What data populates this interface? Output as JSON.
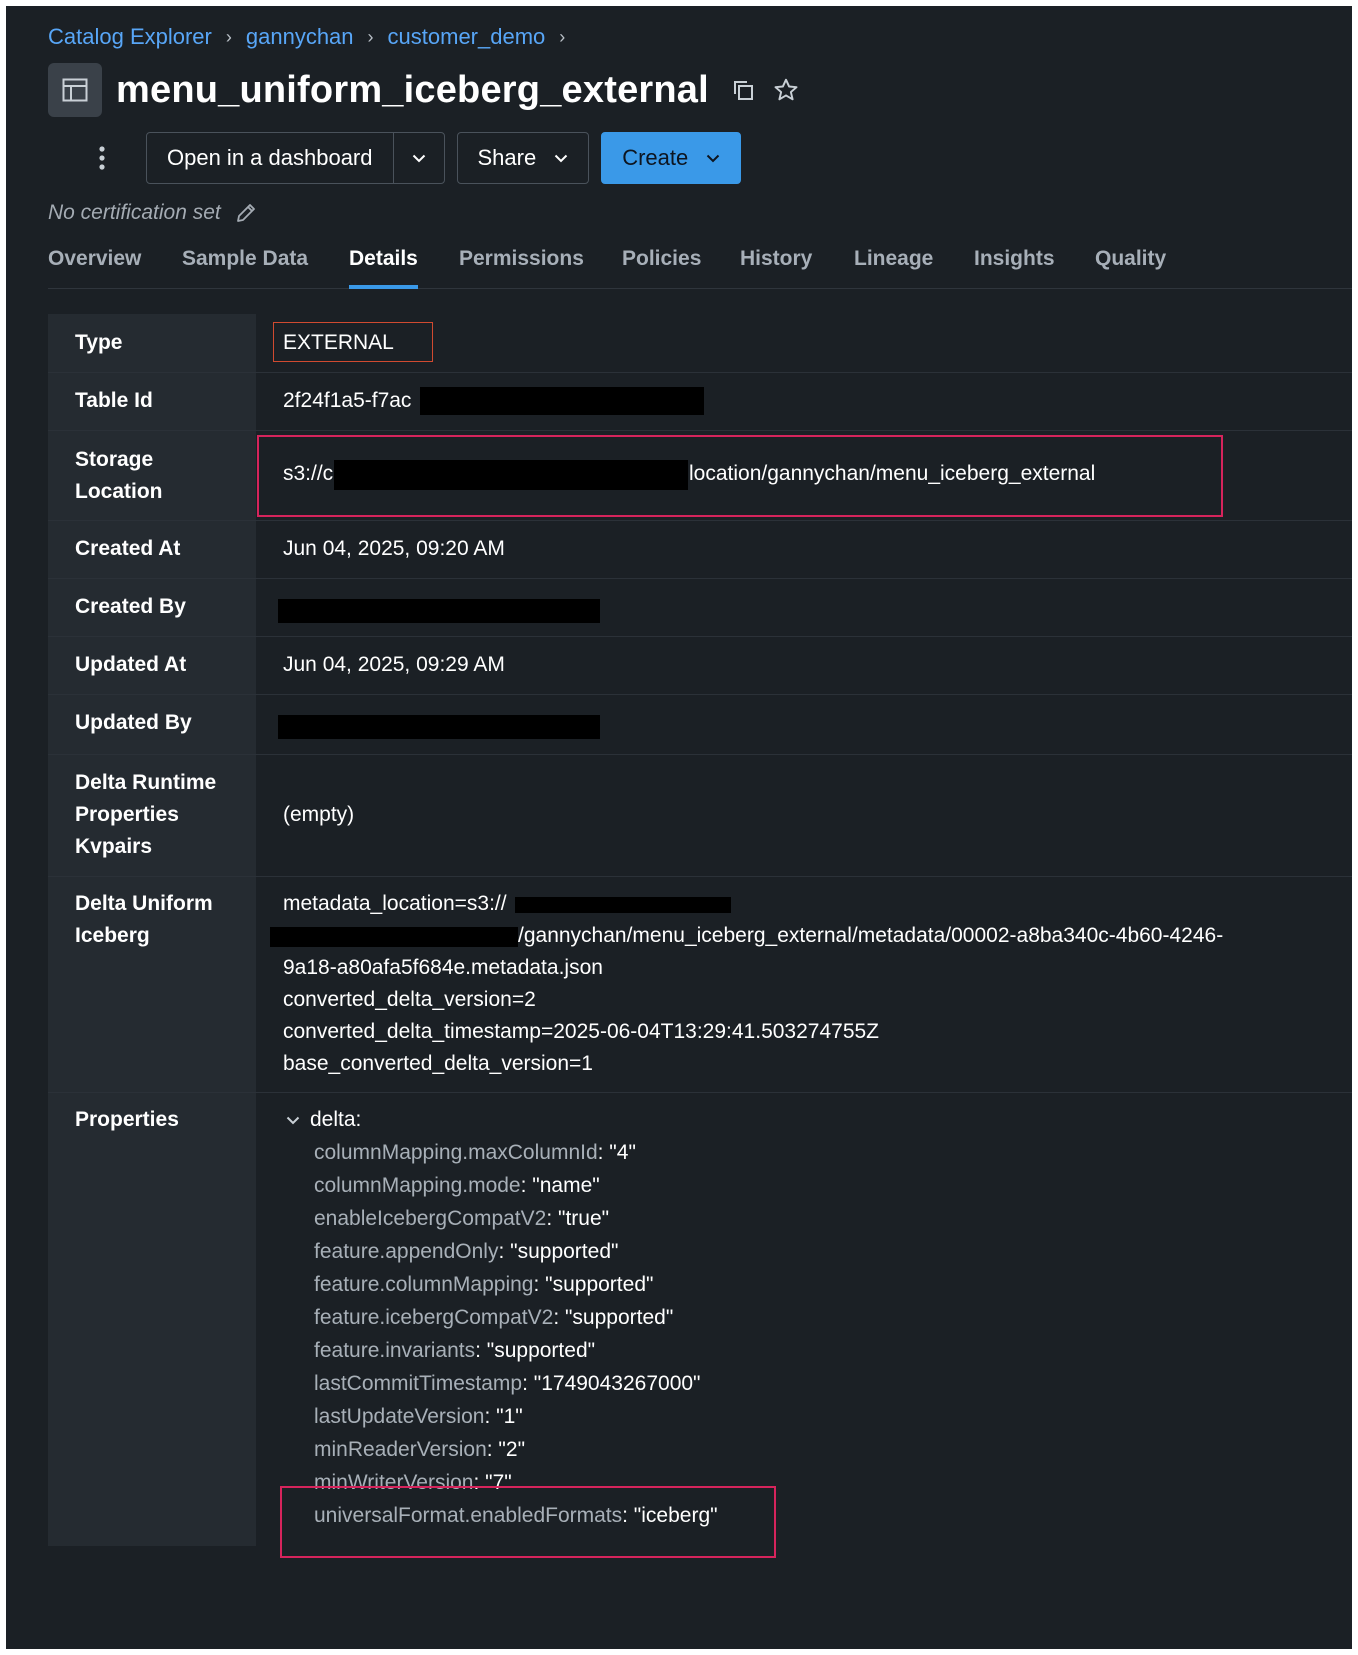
{
  "breadcrumb": {
    "items": [
      "Catalog Explorer",
      "gannychan",
      "customer_demo"
    ],
    "separator": "›"
  },
  "page": {
    "title": "menu_uniform_iceberg_external",
    "certification": "No certification set"
  },
  "toolbar": {
    "open_dashboard_label": "Open in a dashboard",
    "share_label": "Share",
    "create_label": "Create"
  },
  "tabs": [
    "Overview",
    "Sample Data",
    "Details",
    "Permissions",
    "Policies",
    "History",
    "Lineage",
    "Insights",
    "Quality"
  ],
  "active_tab": "Details",
  "details": {
    "type": {
      "label": "Type",
      "value": "EXTERNAL"
    },
    "table_id": {
      "label": "Table Id",
      "value": "2f24f1a5-f7ac"
    },
    "storage_location": {
      "label": "Storage Location",
      "value_prefix": "s3://c",
      "value_suffix": "location/gannychan/menu_iceberg_external"
    },
    "created_at": {
      "label": "Created At",
      "value": "Jun 04, 2025, 09:20 AM"
    },
    "created_by": {
      "label": "Created By"
    },
    "updated_at": {
      "label": "Updated At",
      "value": "Jun 04, 2025, 09:29 AM"
    },
    "updated_by": {
      "label": "Updated By"
    },
    "delta_runtime": {
      "label": "Delta Runtime Properties Kvpairs",
      "value": "(empty)"
    },
    "delta_uniform": {
      "label": "Delta Uniform Iceberg",
      "line1": "metadata_location=s3://",
      "line2": "/gannychan/menu_iceberg_external/metadata/00002-a8ba340c-4b60-4246-",
      "line3": "9a18-a80afa5f684e.metadata.json",
      "line4": "converted_delta_version=2",
      "line5": "converted_delta_timestamp=2025-06-04T13:29:41.503274755Z",
      "line6": "base_converted_delta_version=1"
    },
    "properties": {
      "label": "Properties",
      "group": "delta:",
      "items": [
        {
          "key": "columnMapping.maxColumnId",
          "value": ": \"4\""
        },
        {
          "key": "columnMapping.mode",
          "value": ": \"name\""
        },
        {
          "key": "enableIcebergCompatV2",
          "value": ": \"true\""
        },
        {
          "key": "feature.appendOnly",
          "value": ": \"supported\""
        },
        {
          "key": "feature.columnMapping",
          "value": ": \"supported\""
        },
        {
          "key": "feature.icebergCompatV2",
          "value": ": \"supported\""
        },
        {
          "key": "feature.invariants",
          "value": ": \"supported\""
        },
        {
          "key": "lastCommitTimestamp",
          "value": ": \"1749043267000\""
        },
        {
          "key": "lastUpdateVersion",
          "value": ": \"1\""
        },
        {
          "key": "minReaderVersion",
          "value": ": \"2\""
        },
        {
          "key": "minWriterVersion",
          "value": ": \"7\""
        },
        {
          "key": "universalFormat.enabledFormats",
          "value": ": \"iceberg\""
        }
      ]
    }
  },
  "colors": {
    "background": "#1b2025",
    "label_column": "#252b31",
    "accent": "#3a99e8",
    "link": "#58a6f7",
    "highlight": "#d6245c"
  }
}
